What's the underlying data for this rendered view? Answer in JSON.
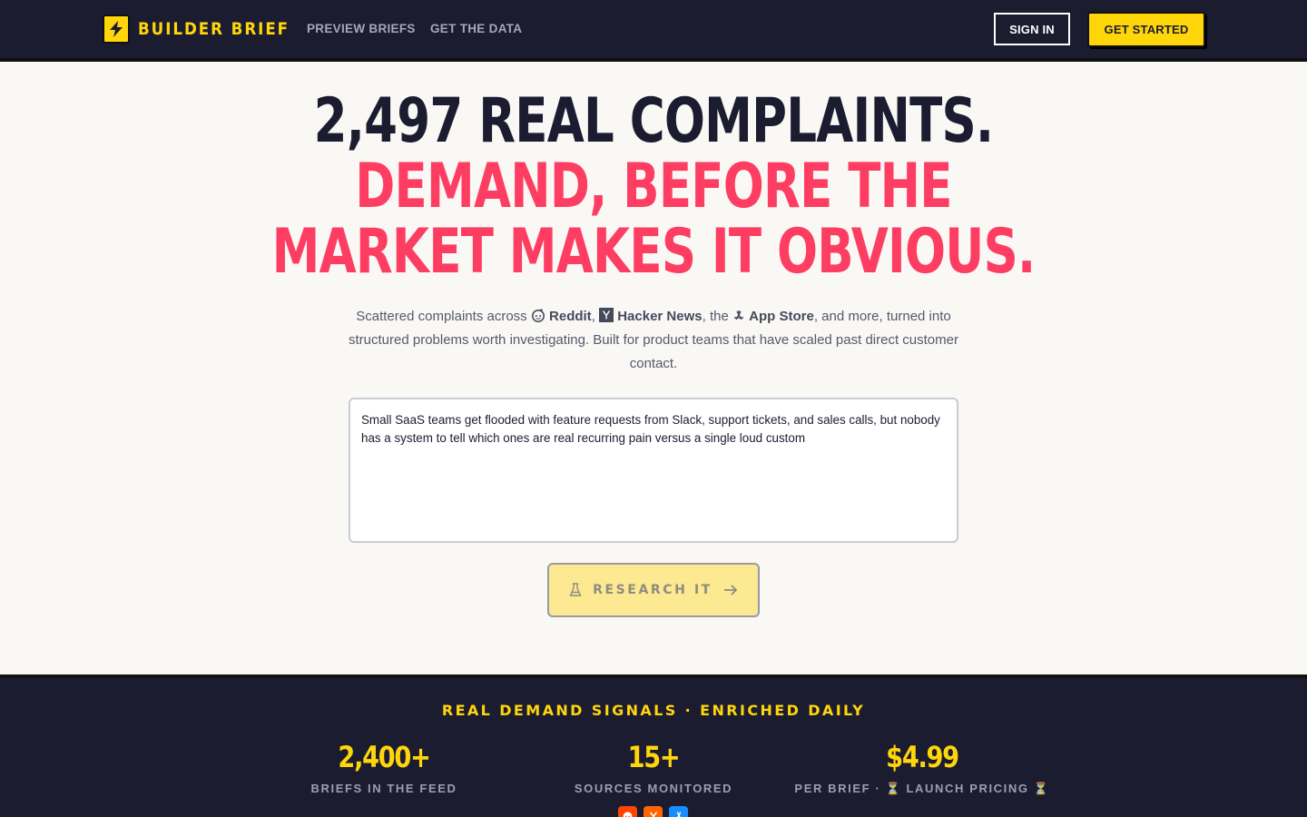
{
  "nav": {
    "brand": "BUILDER BRIEF",
    "links": [
      "PREVIEW BRIEFS",
      "GET THE DATA"
    ],
    "sign_in": "SIGN IN",
    "get_started": "GET STARTED"
  },
  "hero": {
    "line1": "2,497 REAL COMPLAINTS.",
    "line2": "DEMAND, BEFORE THE",
    "line3": "MARKET MAKES IT OBVIOUS.",
    "sub": {
      "prefix": "Scattered complaints across ",
      "source1": "Reddit",
      "sep1": ", ",
      "source2": "Hacker News",
      "sep2": ", the ",
      "source3": "App Store",
      "suffix": ", and more, turned into structured problems worth investigating. Built for product teams that have scaled past direct customer contact."
    },
    "textarea_value": "Small SaaS teams get flooded with feature requests from Slack, support tickets, and sales calls, but nobody has a system to tell which ones are real recurring pain versus a single loud custom",
    "research_button": "RESEARCH IT"
  },
  "stats": {
    "title": "REAL DEMAND SIGNALS · ENRICHED DAILY",
    "items": [
      {
        "value": "2,400+",
        "label": "BRIEFS IN THE FEED"
      },
      {
        "value": "15+",
        "label": "SOURCES MONITORED"
      },
      {
        "value": "$4.99",
        "label": "PER BRIEF · ⏳ LAUNCH PRICING ⏳"
      }
    ],
    "badges": [
      {
        "icon": "reddit-icon",
        "color": "#ff4500"
      },
      {
        "icon": "y-combinator-icon",
        "color": "#ff6600"
      },
      {
        "icon": "app-store-icon",
        "color": "#1a8cff"
      }
    ]
  },
  "colors": {
    "brand_yellow": "#ffd60a",
    "accent_red": "#fe3d62",
    "navy": "#1c1c31"
  }
}
